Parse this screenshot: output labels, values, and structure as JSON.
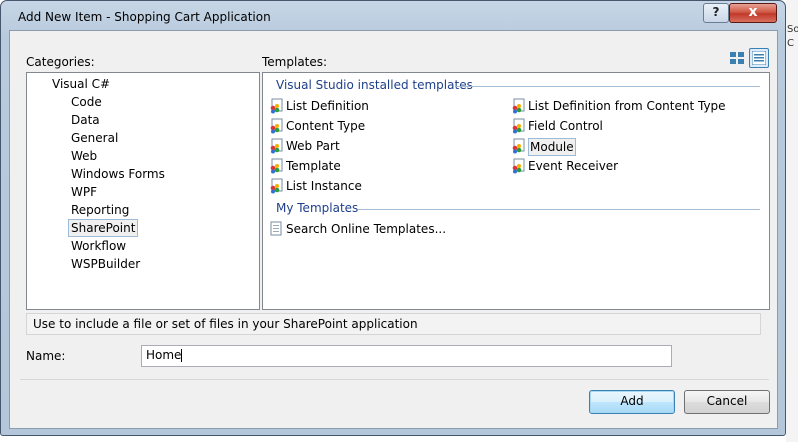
{
  "window": {
    "title": "Add New Item - Shopping Cart Application",
    "help_label": "?",
    "close_label": "x"
  },
  "categories": {
    "label": "Categories:",
    "root": "Visual C#",
    "items": [
      "Code",
      "Data",
      "General",
      "Web",
      "Windows Forms",
      "WPF",
      "Reporting",
      "SharePoint",
      "Workflow",
      "WSPBuilder"
    ],
    "selected": "SharePoint"
  },
  "templates": {
    "label": "Templates:",
    "installed_header": "Visual Studio installed templates",
    "installed": [
      {
        "label": "List Definition",
        "icon": "sharepoint-template-icon"
      },
      {
        "label": "List Definition from Content Type",
        "icon": "sharepoint-template-icon"
      },
      {
        "label": "Content Type",
        "icon": "sharepoint-template-icon"
      },
      {
        "label": "Field Control",
        "icon": "sharepoint-template-icon"
      },
      {
        "label": "Web Part",
        "icon": "sharepoint-template-icon"
      },
      {
        "label": "Module",
        "icon": "sharepoint-template-icon"
      },
      {
        "label": "Template",
        "icon": "sharepoint-template-icon"
      },
      {
        "label": "Event Receiver",
        "icon": "sharepoint-template-icon"
      },
      {
        "label": "List Instance",
        "icon": "sharepoint-template-icon"
      }
    ],
    "selected": "Module",
    "my_header": "My Templates",
    "my": [
      {
        "label": "Search Online Templates...",
        "icon": "search-online-icon"
      }
    ]
  },
  "view_buttons": [
    "large-icons-view-icon",
    "small-icons-view-icon"
  ],
  "description": "Use to include a file or set of files in your SharePoint application",
  "name_field": {
    "label": "Name:",
    "value": "Home"
  },
  "buttons": {
    "add": "Add",
    "cancel": "Cancel"
  },
  "background_chars": [
    "So",
    "C"
  ],
  "colors": {
    "frame": "#b8cadd",
    "client": "#f0f0f0",
    "group_header": "#1e3f8a",
    "close_button": "#c0392b"
  }
}
